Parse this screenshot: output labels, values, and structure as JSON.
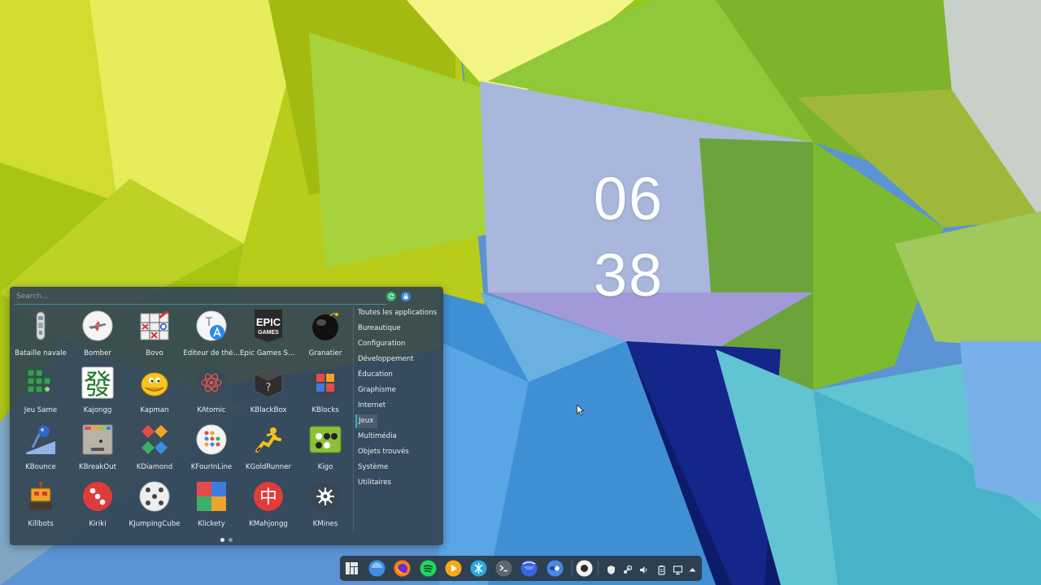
{
  "clock": {
    "hours": "06",
    "minutes": "38"
  },
  "launcher": {
    "search_placeholder": "Search...",
    "apps": [
      {
        "label": "Bataille navale",
        "icon": "battleship-icon"
      },
      {
        "label": "Bomber",
        "icon": "plane-icon"
      },
      {
        "label": "Bovo",
        "icon": "tic-tac-toe-icon"
      },
      {
        "label": "Éditeur de thè...",
        "icon": "theme-editor-icon"
      },
      {
        "label": "Epic Games St...",
        "icon": "epic-games-icon"
      },
      {
        "label": "Granatier",
        "icon": "bomb-icon"
      },
      {
        "label": "Jeu Same",
        "icon": "same-game-icon"
      },
      {
        "label": "Kajongg",
        "icon": "kajongg-icon"
      },
      {
        "label": "Kapman",
        "icon": "kapman-icon"
      },
      {
        "label": "KAtomic",
        "icon": "atom-icon"
      },
      {
        "label": "KBlackBox",
        "icon": "blackbox-icon"
      },
      {
        "label": "KBlocks",
        "icon": "blocks-icon"
      },
      {
        "label": "KBounce",
        "icon": "bounce-icon"
      },
      {
        "label": "KBreakOut",
        "icon": "breakout-icon"
      },
      {
        "label": "KDiamond",
        "icon": "diamond-icon"
      },
      {
        "label": "KFourInLine",
        "icon": "four-in-line-icon"
      },
      {
        "label": "KGoldRunner",
        "icon": "goldrunner-icon"
      },
      {
        "label": "Kigo",
        "icon": "go-board-icon"
      },
      {
        "label": "Killbots",
        "icon": "robot-icon"
      },
      {
        "label": "Kiriki",
        "icon": "dice-icon"
      },
      {
        "label": "KJumpingCube",
        "icon": "jumping-cube-icon"
      },
      {
        "label": "Klickety",
        "icon": "klickety-icon"
      },
      {
        "label": "KMahjongg",
        "icon": "mahjongg-icon"
      },
      {
        "label": "KMines",
        "icon": "mine-icon"
      }
    ],
    "categories": [
      {
        "label": "Toutes les applications"
      },
      {
        "label": "Bureautique"
      },
      {
        "label": "Configuration"
      },
      {
        "label": "Développement"
      },
      {
        "label": "Éducation"
      },
      {
        "label": "Graphisme"
      },
      {
        "label": "Internet"
      },
      {
        "label": "Jeux",
        "active": true
      },
      {
        "label": "Multimédia"
      },
      {
        "label": "Objets trouvés"
      },
      {
        "label": "Système"
      },
      {
        "label": "Utilitaires"
      }
    ],
    "icon_text": {
      "epic_line1": "EPIC",
      "epic_line2": "GAMES",
      "kajongg_glyph": "發",
      "mahjongg_glyph": "中"
    },
    "pages": {
      "count": 2,
      "current": 1
    }
  },
  "taskbar": {
    "apps": [
      {
        "name": "manjaro-menu-icon"
      },
      {
        "name": "file-manager-icon"
      },
      {
        "name": "firefox-icon"
      },
      {
        "name": "spotify-icon"
      },
      {
        "name": "media-player-icon"
      },
      {
        "name": "network-app-icon"
      },
      {
        "name": "terminal-icon"
      },
      {
        "name": "blue-app-icon"
      },
      {
        "name": "toggle-app-icon"
      },
      {
        "name": "active-window-icon"
      }
    ],
    "tray": [
      {
        "name": "shield-icon"
      },
      {
        "name": "steam-icon"
      },
      {
        "name": "volume-icon"
      },
      {
        "name": "clipboard-icon"
      },
      {
        "name": "display-icon"
      },
      {
        "name": "expand-arrow-icon"
      }
    ]
  },
  "colors": {
    "accent": "#3fa7d6",
    "panel_bg": "#344654",
    "taskbar_bg": "#2c3c48"
  }
}
